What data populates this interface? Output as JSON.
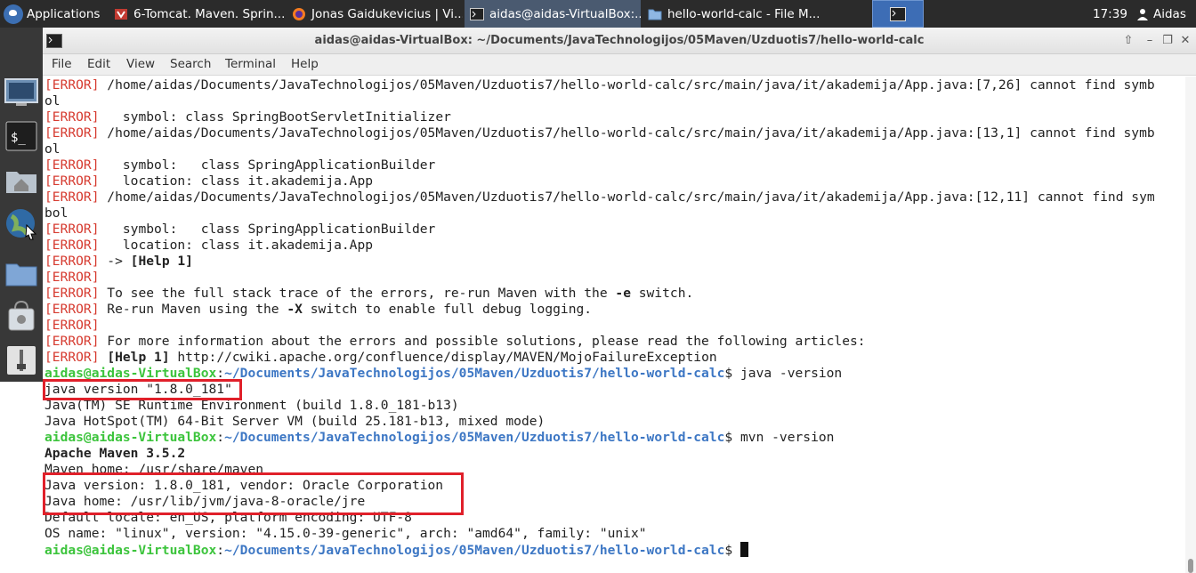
{
  "panel": {
    "apps_label": "Applications",
    "tasks": [
      {
        "label": "6-Tomcat. Maven. Sprin..."
      },
      {
        "label": "Jonas Gaidukevicius | Vi..."
      },
      {
        "label": "aidas@aidas-VirtualBox:..."
      },
      {
        "label": "hello-world-calc - File M..."
      }
    ],
    "clock": "17:39",
    "user": "Aidas"
  },
  "window": {
    "title": "aidas@aidas-VirtualBox: ~/Documents/JavaTechnologijos/05Maven/Uzduotis7/hello-world-calc",
    "menu": [
      "File",
      "Edit",
      "View",
      "Search",
      "Terminal",
      "Help"
    ]
  },
  "terminal": {
    "err_tag": "[ERROR]",
    "prompt_user": "aidas@aidas-VirtualBox",
    "prompt_path": "~/Documents/JavaTechnologijos/05Maven/Uzduotis7/hello-world-calc",
    "lines": {
      "l1": " /home/aidas/Documents/JavaTechnologijos/05Maven/Uzduotis7/hello-world-calc/src/main/java/it/akademija/App.java:[7,26] cannot find symb",
      "l2": "ol",
      "l3": "   symbol: class SpringBootServletInitializer",
      "l4": " /home/aidas/Documents/JavaTechnologijos/05Maven/Uzduotis7/hello-world-calc/src/main/java/it/akademija/App.java:[13,1] cannot find symb",
      "l5": "ol",
      "l6": "   symbol:   class SpringApplicationBuilder",
      "l7": "   location: class it.akademija.App",
      "l8": " /home/aidas/Documents/JavaTechnologijos/05Maven/Uzduotis7/hello-world-calc/src/main/java/it/akademija/App.java:[12,11] cannot find sym",
      "l9": "bol",
      "l10": "   symbol:   class SpringApplicationBuilder",
      "l11": "   location: class it.akademija.App",
      "l12a": " -> ",
      "l12b": "[Help 1]",
      "l14a": " To see the full stack trace of the errors, re-run Maven with the ",
      "l14b": "-e",
      "l14c": " switch.",
      "l15a": " Re-run Maven using the ",
      "l15b": "-X",
      "l15c": " switch to enable full debug logging.",
      "l17": " For more information about the errors and possible solutions, please read the following articles:",
      "l18a": " ",
      "l18b": "[Help 1]",
      "l18c": " http://cwiki.apache.org/confluence/display/MAVEN/MojoFailureException",
      "cmd1": "$ java -version",
      "j1": "java version \"1.8.0_181\"",
      "j2": "Java(TM) SE Runtime Environment (build 1.8.0_181-b13)",
      "j3": "Java HotSpot(TM) 64-Bit Server VM (build 25.181-b13, mixed mode)",
      "cmd2": "$ mvn -version",
      "m1": "Apache Maven 3.5.2",
      "m2": "Maven home: /usr/share/maven",
      "m3": "Java version: 1.8.0_181, vendor: Oracle Corporation",
      "m4": "Java home: /usr/lib/jvm/java-8-oracle/jre",
      "m5": "Default locale: en_US, platform encoding: UTF-8",
      "m6": "OS name: \"linux\", version: \"4.15.0-39-generic\", arch: \"amd64\", family: \"unix\"",
      "cmd3": "$ "
    }
  },
  "colors": {
    "error": "#d63a2f",
    "prompt_user": "#3cc43c",
    "prompt_path": "#3d77c4",
    "highlight": "#e0202a"
  }
}
